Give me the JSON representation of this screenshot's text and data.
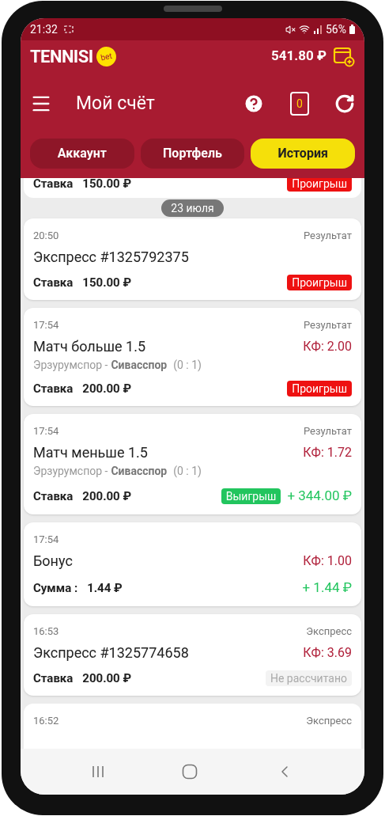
{
  "status_bar": {
    "time": "21:32",
    "battery": "56%"
  },
  "header": {
    "logo": "TENNISI",
    "logo_badge": "bet",
    "balance": "541.80 ₽",
    "title": "Мой счёт",
    "coupon_count": "0"
  },
  "tabs": [
    {
      "label": "Аккаунт",
      "selected": false
    },
    {
      "label": "Портфель",
      "selected": false
    },
    {
      "label": "История",
      "selected": true
    }
  ],
  "clipped_card": {
    "stake_label": "Ставка",
    "stake_amount": "150.00 ₽",
    "status": {
      "kind": "loss",
      "text": "Проигрыш"
    }
  },
  "date_pill": "23 июля",
  "cards": [
    {
      "time": "20:50",
      "type_label": "Результат",
      "title": "Экспресс #1325792375",
      "stake_label": "Ставка",
      "stake_amount": "150.00 ₽",
      "status": {
        "kind": "loss",
        "text": "Проигрыш"
      }
    },
    {
      "time": "17:54",
      "type_label": "Результат",
      "title": "Матч больше 1.5",
      "odds": "КФ: 2.00",
      "match": {
        "home": "Эрзурумспор -",
        "away": "Сивасспор",
        "score": "(0 : 1)"
      },
      "stake_label": "Ставка",
      "stake_amount": "200.00 ₽",
      "status": {
        "kind": "loss",
        "text": "Проигрыш"
      }
    },
    {
      "time": "17:54",
      "type_label": "Результат",
      "title": "Матч меньше 1.5",
      "odds": "КФ: 1.72",
      "match": {
        "home": "Эрзурумспор -",
        "away": "Сивасспор",
        "score": "(0 : 1)"
      },
      "stake_label": "Ставка",
      "stake_amount": "200.00 ₽",
      "status": {
        "kind": "win",
        "text": "Выигрыш"
      },
      "payout": "+ 344.00 ₽"
    },
    {
      "time": "17:54",
      "title": "Бонус",
      "odds": "КФ: 1.00",
      "stake_label": "Сумма :",
      "stake_amount": "1.44 ₽",
      "payout": "+ 1.44 ₽"
    },
    {
      "time": "16:53",
      "type_label": "Экспресс",
      "title": "Экспресс #1325774658",
      "odds": "КФ: 3.69",
      "stake_label": "Ставка",
      "stake_amount": "200.00 ₽",
      "status": {
        "kind": "pending",
        "text": "Не рассчитано"
      }
    }
  ],
  "partial_card": {
    "time": "16:52",
    "type_label": "Экспресс"
  }
}
